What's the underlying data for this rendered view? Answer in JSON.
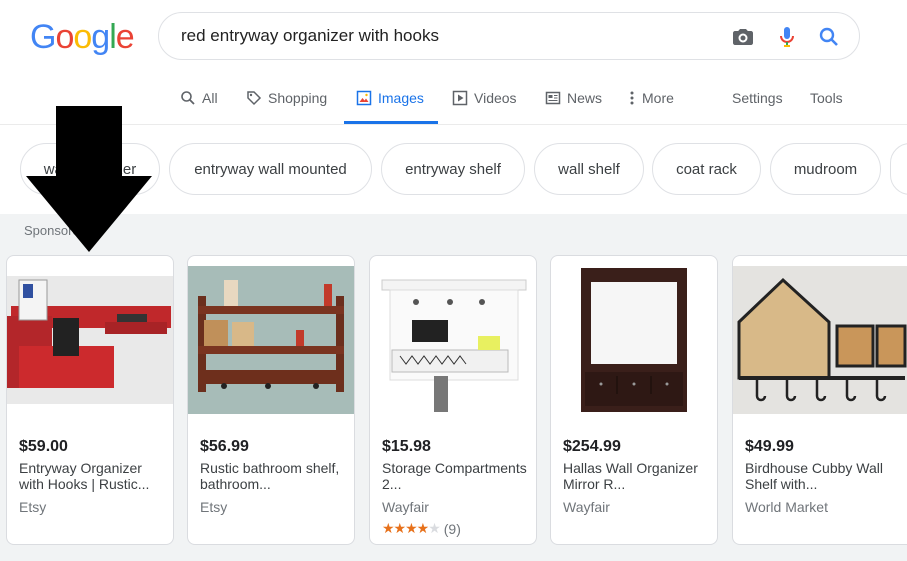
{
  "search": {
    "logo": "Google",
    "query": "red entryway organizer with hooks"
  },
  "tabs": [
    {
      "label": "All",
      "icon": "search-icon",
      "active": false
    },
    {
      "label": "Shopping",
      "icon": "tag-icon",
      "active": false
    },
    {
      "label": "Images",
      "icon": "image-icon",
      "active": true
    },
    {
      "label": "Videos",
      "icon": "play-icon",
      "active": false
    },
    {
      "label": "News",
      "icon": "newspaper-icon",
      "active": false
    },
    {
      "label": "More",
      "icon": "more-vert-icon",
      "active": false
    }
  ],
  "tools": {
    "settings": "Settings",
    "tools": "Tools"
  },
  "chips": [
    "wall organizer",
    "entryway wall mounted",
    "entryway shelf",
    "wall shelf",
    "coat rack",
    "mudroom"
  ],
  "sponsored_label": "Sponsored",
  "products": [
    {
      "price": "$59.00",
      "title": "Entryway Organizer with Hooks | Rustic...",
      "merchant": "Etsy"
    },
    {
      "price": "$56.99",
      "title": "Rustic bathroom shelf, bathroom...",
      "merchant": "Etsy"
    },
    {
      "price": "$15.98",
      "title": "Storage Compartments 2...",
      "merchant": "Wayfair",
      "rating": 4,
      "reviews": "(9)"
    },
    {
      "price": "$254.99",
      "title": "Hallas Wall Organizer Mirror R...",
      "merchant": "Wayfair"
    },
    {
      "price": "$49.99",
      "title": "Birdhouse Cubby Wall Shelf with...",
      "merchant": "World Market"
    }
  ],
  "colors": {
    "accent": "#1a73e8",
    "star": "#e7711b",
    "arrow": "#000000"
  }
}
